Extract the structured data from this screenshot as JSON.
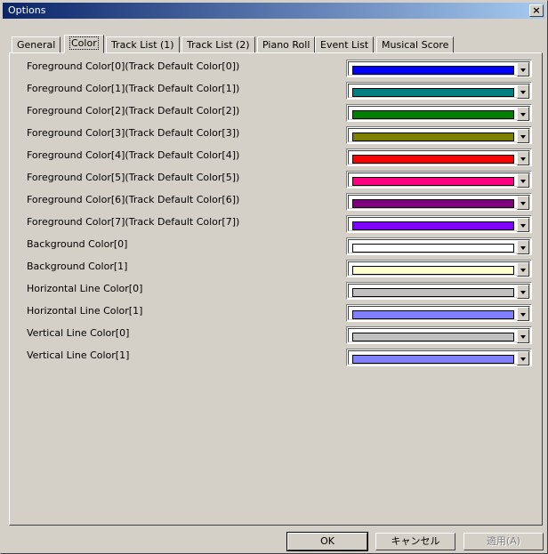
{
  "window": {
    "title": "Options",
    "close_glyph": "×"
  },
  "tabs": [
    "General",
    "Color",
    "Track List (1)",
    "Track List (2)",
    "Piano Roll",
    "Event List",
    "Musical Score"
  ],
  "active_tab": "Color",
  "color_settings": [
    {
      "label": "Foreground Color[0](Track Default Color[0])",
      "color": "#0000ff"
    },
    {
      "label": "Foreground Color[1](Track Default Color[1])",
      "color": "#008080"
    },
    {
      "label": "Foreground Color[2](Track Default Color[2])",
      "color": "#008000"
    },
    {
      "label": "Foreground Color[3](Track Default Color[3])",
      "color": "#808000"
    },
    {
      "label": "Foreground Color[4](Track Default Color[4])",
      "color": "#ff0000"
    },
    {
      "label": "Foreground Color[5](Track Default Color[5])",
      "color": "#ff0080"
    },
    {
      "label": "Foreground Color[6](Track Default Color[6])",
      "color": "#800080"
    },
    {
      "label": "Foreground Color[7](Track Default Color[7])",
      "color": "#8000ff"
    },
    {
      "label": "Background Color[0]",
      "color": "#ffffff"
    },
    {
      "label": "Background Color[1]",
      "color": "#ffffcc"
    },
    {
      "label": "Horizontal Line Color[0]",
      "color": "#c0c0c0"
    },
    {
      "label": "Horizontal Line Color[1]",
      "color": "#8080ff"
    },
    {
      "label": "Vertical Line Color[0]",
      "color": "#c0c0c0"
    },
    {
      "label": "Vertical Line Color[1]",
      "color": "#8080ff"
    }
  ],
  "buttons": {
    "ok": "OK",
    "cancel": "キャンセル",
    "apply": "適用(A)"
  }
}
